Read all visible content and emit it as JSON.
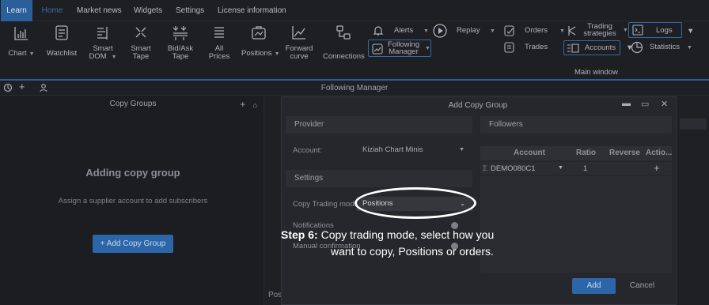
{
  "menu": {
    "items": [
      "Learn",
      "Home",
      "Market news",
      "Widgets",
      "Settings",
      "License information"
    ]
  },
  "ribbon": {
    "chart": "Chart",
    "watchlist": "Watchlist",
    "smart_dom": [
      "Smart",
      "DOM"
    ],
    "smart_tape": [
      "Smart",
      "Tape"
    ],
    "bid_ask_tape": [
      "Bid/Ask",
      "Tape"
    ],
    "all_prices": [
      "All",
      "Prices"
    ],
    "positions": "Positions",
    "forward_curve": [
      "Forward",
      "curve"
    ],
    "connections": "Connections",
    "alerts": "Alerts",
    "following_manager": [
      "Following",
      "Manager"
    ],
    "replay": "Replay",
    "orders": "Orders",
    "trades": "Trades",
    "trading_strategies": [
      "Trading",
      "strategies"
    ],
    "accounts": "Accounts",
    "logs": "Logs",
    "statistics": "Statistics",
    "main_window": "Main window"
  },
  "toolbar": {
    "title": "Following Manager"
  },
  "copy_groups": {
    "header": "Copy Groups",
    "empty_title": "Adding copy group",
    "empty_sub": "Assign a supplier account to add subscribers",
    "add_button": "+ Add Copy Group",
    "bottom_tab": "Posi"
  },
  "dialog": {
    "title": "Add Copy Group",
    "provider_header": "Provider",
    "account_label": "Account:",
    "account_value": "Kiziah Chart Minis",
    "settings_header": "Settings",
    "copy_mode_label": "Copy Trading mode",
    "copy_mode_value": "Positions",
    "notifications_label": "Notifications",
    "manual_label": "Manual confirmation",
    "followers_header": "Followers",
    "columns": [
      "Account",
      "Ratio",
      "Reverse",
      "Actio..."
    ],
    "row": {
      "account": "DEMO080C1",
      "ratio": "1"
    },
    "add_button": "Add",
    "cancel_button": "Cancel"
  },
  "annotation": {
    "step": "Step 6:",
    "line1": "Copy trading mode, select how you",
    "line2": "want to copy, Positions or orders."
  },
  "colors": {
    "accent": "#2d66a8",
    "background": "#1c1d21",
    "highlight_oval": "#ffffff"
  }
}
